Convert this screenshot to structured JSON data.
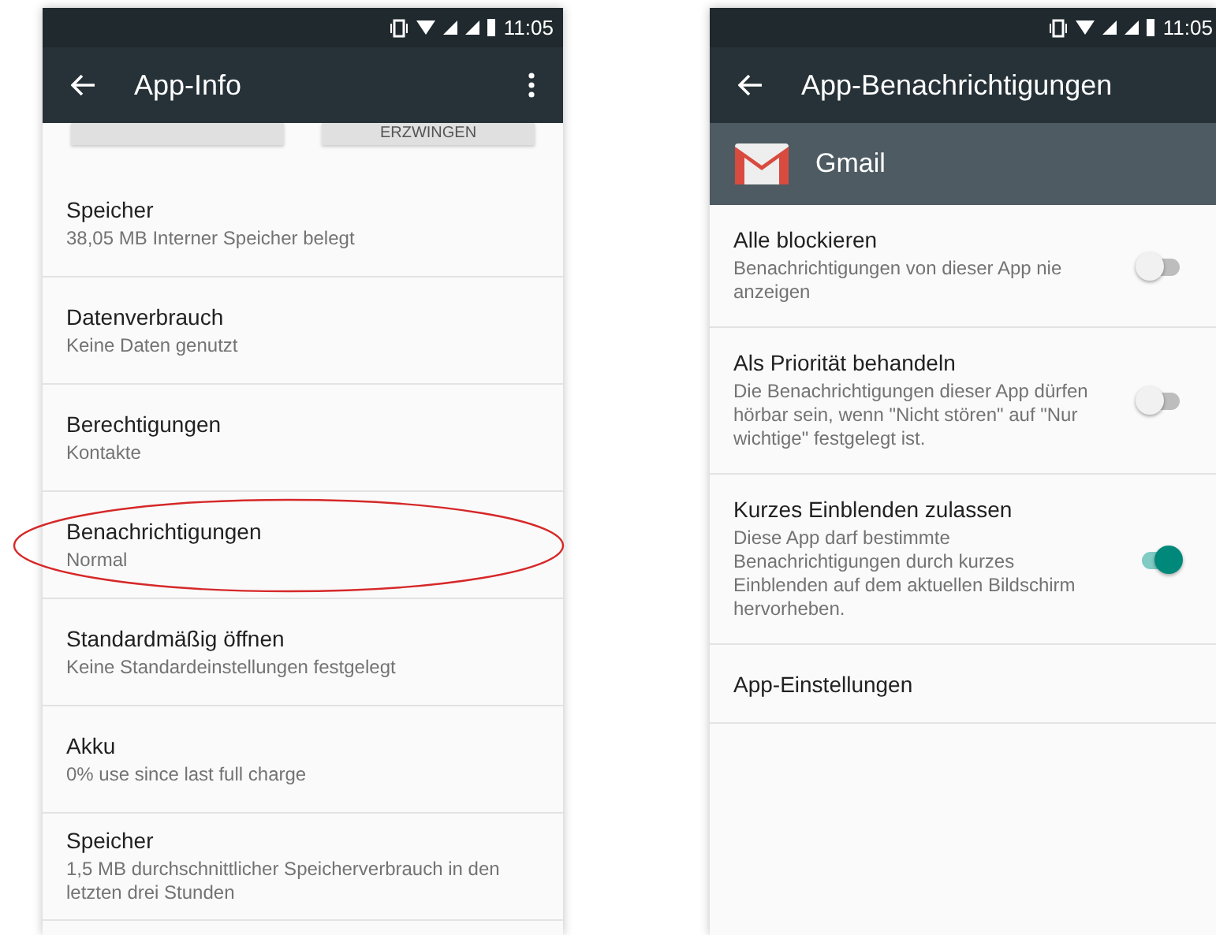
{
  "left_screen": {
    "status_bar": {
      "time": "11:05"
    },
    "toolbar": {
      "title": "App-Info"
    },
    "top_buttons": [
      {
        "kind": "blank"
      },
      {
        "kind": "text",
        "label": "ERZWINGEN"
      }
    ],
    "items": [
      {
        "title": "Speicher",
        "subtitle": "38,05 MB Interner Speicher belegt",
        "highlighted": false
      },
      {
        "title": "Datenverbrauch",
        "subtitle": "Keine Daten genutzt",
        "highlighted": false
      },
      {
        "title": "Berechtigungen",
        "subtitle": "Kontakte",
        "highlighted": false
      },
      {
        "title": "Benachrichtigungen",
        "subtitle": "Normal",
        "highlighted": true
      },
      {
        "title": "Standardmäßig öffnen",
        "subtitle": "Keine Standardeinstellungen festgelegt",
        "highlighted": false
      },
      {
        "title": "Akku",
        "subtitle": "0% use since last full charge",
        "highlighted": false
      },
      {
        "title": "Speicher",
        "subtitle": "1,5 MB durchschnittlicher Speicherverbrauch in den letzten drei Stunden",
        "highlighted": false
      }
    ]
  },
  "right_screen": {
    "status_bar": {
      "time": "11:05"
    },
    "toolbar": {
      "title": "App-Benachrichtigungen"
    },
    "app_header": {
      "name": "Gmail"
    },
    "items": [
      {
        "kind": "switch",
        "title": "Alle blockieren",
        "subtitle": "Benachrichtigungen von dieser App nie anzeigen",
        "on": false
      },
      {
        "kind": "switch",
        "title": "Als Priorität behandeln",
        "subtitle": "Die Benachrichtigungen dieser App dürfen hörbar sein, wenn \"Nicht stören\" auf \"Nur wichtige\" festgelegt ist.",
        "on": false
      },
      {
        "kind": "switch",
        "title": "Kurzes Einblenden zulassen",
        "subtitle": "Diese App darf bestimmte Benachrichtigungen durch kurzes Einblenden auf dem aktuellen Bildschirm hervorheben.",
        "on": true
      },
      {
        "kind": "link",
        "title": "App-Einstellungen"
      }
    ]
  }
}
